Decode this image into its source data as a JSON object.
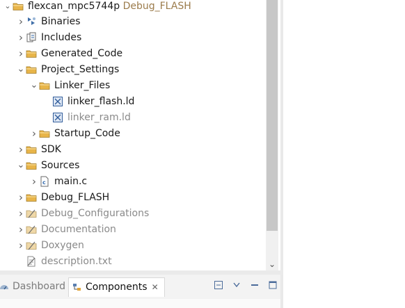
{
  "project": {
    "name": "flexcan_mpc5744p",
    "config": " Debug_FLASH"
  },
  "tree": [
    {
      "label": "Binaries",
      "icon": "binaries-icon",
      "expander": "collapsed",
      "dim": false
    },
    {
      "label": "Includes",
      "icon": "includes-icon",
      "expander": "collapsed",
      "dim": false
    },
    {
      "label": "Generated_Code",
      "icon": "folder-icon",
      "expander": "collapsed",
      "dim": false
    },
    {
      "label": "Project_Settings",
      "icon": "folder-icon",
      "expander": "expanded",
      "dim": false
    },
    {
      "label": "Linker_Files",
      "icon": "folder-icon",
      "expander": "expanded",
      "dim": false
    },
    {
      "label": "linker_flash.ld",
      "icon": "linker-file-icon",
      "expander": "none",
      "dim": false
    },
    {
      "label": "linker_ram.ld",
      "icon": "linker-file-icon",
      "expander": "none",
      "dim": true
    },
    {
      "label": "Startup_Code",
      "icon": "folder-icon",
      "expander": "collapsed",
      "dim": false
    },
    {
      "label": "SDK",
      "icon": "folder-icon",
      "expander": "collapsed",
      "dim": false
    },
    {
      "label": "Sources",
      "icon": "folder-icon",
      "expander": "expanded",
      "dim": false
    },
    {
      "label": "main.c",
      "icon": "c-file-icon",
      "expander": "collapsed",
      "dim": false
    },
    {
      "label": "Debug_FLASH",
      "icon": "folder-icon",
      "expander": "collapsed",
      "dim": false
    },
    {
      "label": "Debug_Configurations",
      "icon": "excluded-folder-icon",
      "expander": "collapsed",
      "dim": true
    },
    {
      "label": "Documentation",
      "icon": "excluded-folder-icon",
      "expander": "collapsed",
      "dim": true
    },
    {
      "label": "Doxygen",
      "icon": "excluded-folder-icon",
      "expander": "collapsed",
      "dim": true
    },
    {
      "label": "description.txt",
      "icon": "excluded-file-icon",
      "expander": "none",
      "dim": true
    }
  ],
  "tabs": {
    "dashboard": "Dashboard",
    "components": "Components",
    "close_glyph": "✕"
  },
  "scrollbar": {
    "down_glyph": "⌄"
  },
  "colors": {
    "folder": "#e8b54a",
    "accent": "#3a6fb0",
    "dim_text": "#8a8a8a"
  }
}
